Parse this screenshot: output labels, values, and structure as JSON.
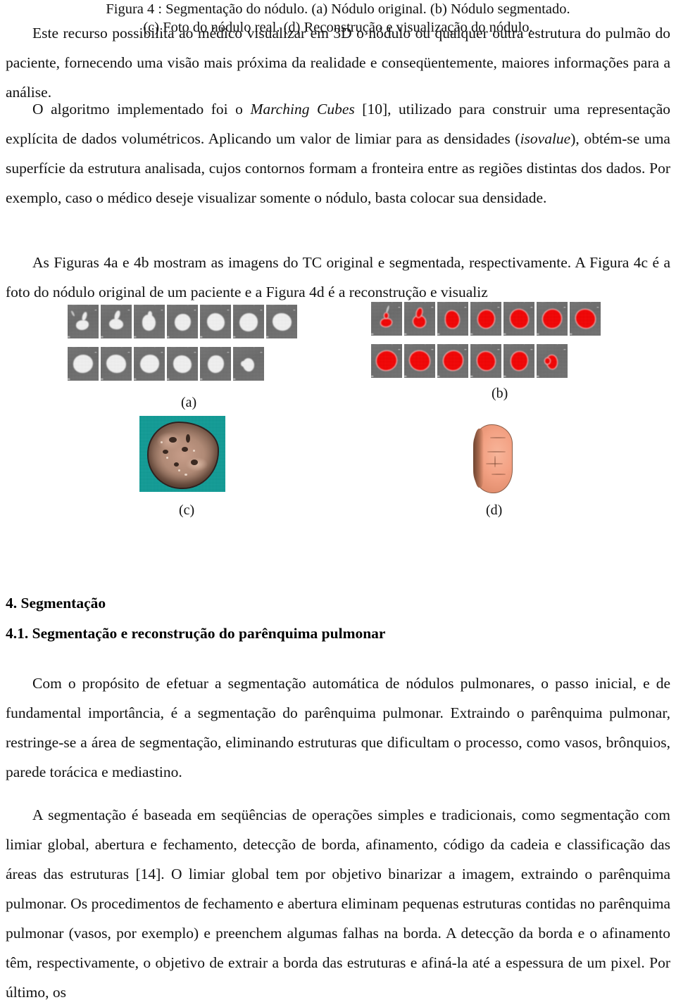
{
  "document": {
    "language": "pt-BR",
    "paragraphs": {
      "p1_a": "Este recurso possibilita ao médico visualizar em 3D o nódulo ou qualquer outra estrutura do pulmão do paciente, fornecendo uma visão mais próxima da realidade e conseqüentemente, maiores informações para a análise.",
      "p2_lead": "O algoritmo implementado foi o ",
      "p2_italic": "Marching Cubes",
      "p2_mid": " [10], utilizado para construir uma representação explícita de dados volumétricos. Aplicando um valor de  limiar para as densidades (",
      "p2_italic2": "isovalue",
      "p2_tail": "), obtém-se uma superfície da estrutura analisada, cujos contornos formam a fronteira entre as regiões distintas dos dados. Por exemplo, caso o médico deseje visualizar somente o nódulo, basta colocar sua densidade.",
      "p3": "As Figuras 4a  e 4b mostram as imagens do TC original e segmentada, respectivamente.  A Figura 4c é a foto do nódulo original de um paciente e a Figura 4d é a reconstrução e visualiz",
      "p4": "Com o propósito de efetuar a segmentação automática de nódulos pulmonares, o passo inicial, e de fundamental importância, é a segmentação do parênquima pulmonar. Extraindo o parênquima pulmonar, restringe-se a área de segmentação, eliminando estruturas que dificultam o processo, como vasos, brônquios, parede torácica e mediastino.",
      "p5": "A segmentação é baseada em seqüências de operações simples e tradicionais, como segmentação com limiar global,  abertura e fechamento, detecção de borda, afinamento, código da cadeia e classificação das áreas das estruturas [14]. O limiar global  tem por objetivo binarizar a imagem, extraindo o parênquima pulmonar. Os procedimentos de  fechamento e abertura eliminam pequenas estruturas contidas no parênquima pulmonar (vasos, por exemplo) e preenchem algumas falhas na borda. A detecção da borda e o afinamento têm, respectivamente, o objetivo de extrair a  borda das estruturas e afiná-la até a espessura de um pixel. Por último, os"
    },
    "headings": {
      "section_4": "4. Segmentação",
      "section_4_1": "4.1. Segmentação e reconstrução do parênquima pulmonar"
    },
    "figure": {
      "number": "Figura 4",
      "caption_line_1": "Figura 4 : Segmentação do nódulo. (a) Nódulo original. (b) Nódulo segmentado.",
      "caption_line_2": "(c) Foto do nódulo real. (d) Reconstrução e visualização do nódulo.",
      "panel_labels": {
        "a": "(a)",
        "b": "(b)",
        "c": "(c)",
        "d": "(d)"
      },
      "panels": {
        "a": {
          "description": "Nódulo original",
          "tiles_row_1": 7,
          "tiles_row_2": 6,
          "total_tiles": 13,
          "nodule_color": "#f4f4f4",
          "background_color": "#6e6e6e"
        },
        "b": {
          "description": "Nódulo segmentado",
          "tiles_row_1": 7,
          "tiles_row_2": 6,
          "total_tiles": 13,
          "nodule_color": "#f60000",
          "contour_color": "#ffb0b0",
          "background_color": "#6e6e6e"
        },
        "c": {
          "description": "Foto do nódulo real",
          "background_color": "#0e9d97",
          "specimen_color": "#b08a76"
        },
        "d": {
          "description": "Reconstrução e visualização do nódulo",
          "surface_color": "#f3a183",
          "shadow_color": "#6d4330"
        }
      }
    },
    "references_cited": [
      "[10]",
      "[14]"
    ]
  }
}
